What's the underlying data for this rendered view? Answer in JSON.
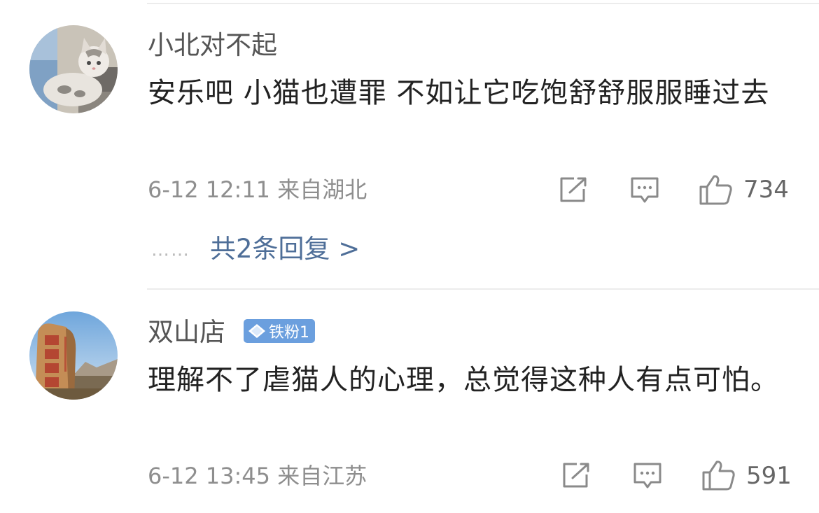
{
  "comments": [
    {
      "username": "小北对不起",
      "text": "安乐吧 小猫也遭罪 不如让它吃饱舒舒服服睡过去",
      "meta": "6-12 12:11 来自湖北",
      "likes": "734",
      "avatar": "cat-photo",
      "replies": {
        "dots": "……",
        "label": "共2条回复 >"
      }
    },
    {
      "username": "双山店",
      "badge": "铁粉1",
      "text": "理解不了虐猫人的心理，总觉得这种人有点可怕。",
      "meta": "6-12 13:45 来自江苏",
      "likes": "591",
      "avatar": "rock-monument-photo"
    }
  ],
  "icons": [
    "share-icon",
    "comment-icon",
    "thumbs-up-icon",
    "diamond-icon"
  ],
  "colors": {
    "link": "#4e6e98",
    "badge": "#6b9fde",
    "meta": "#8e8e8e"
  }
}
